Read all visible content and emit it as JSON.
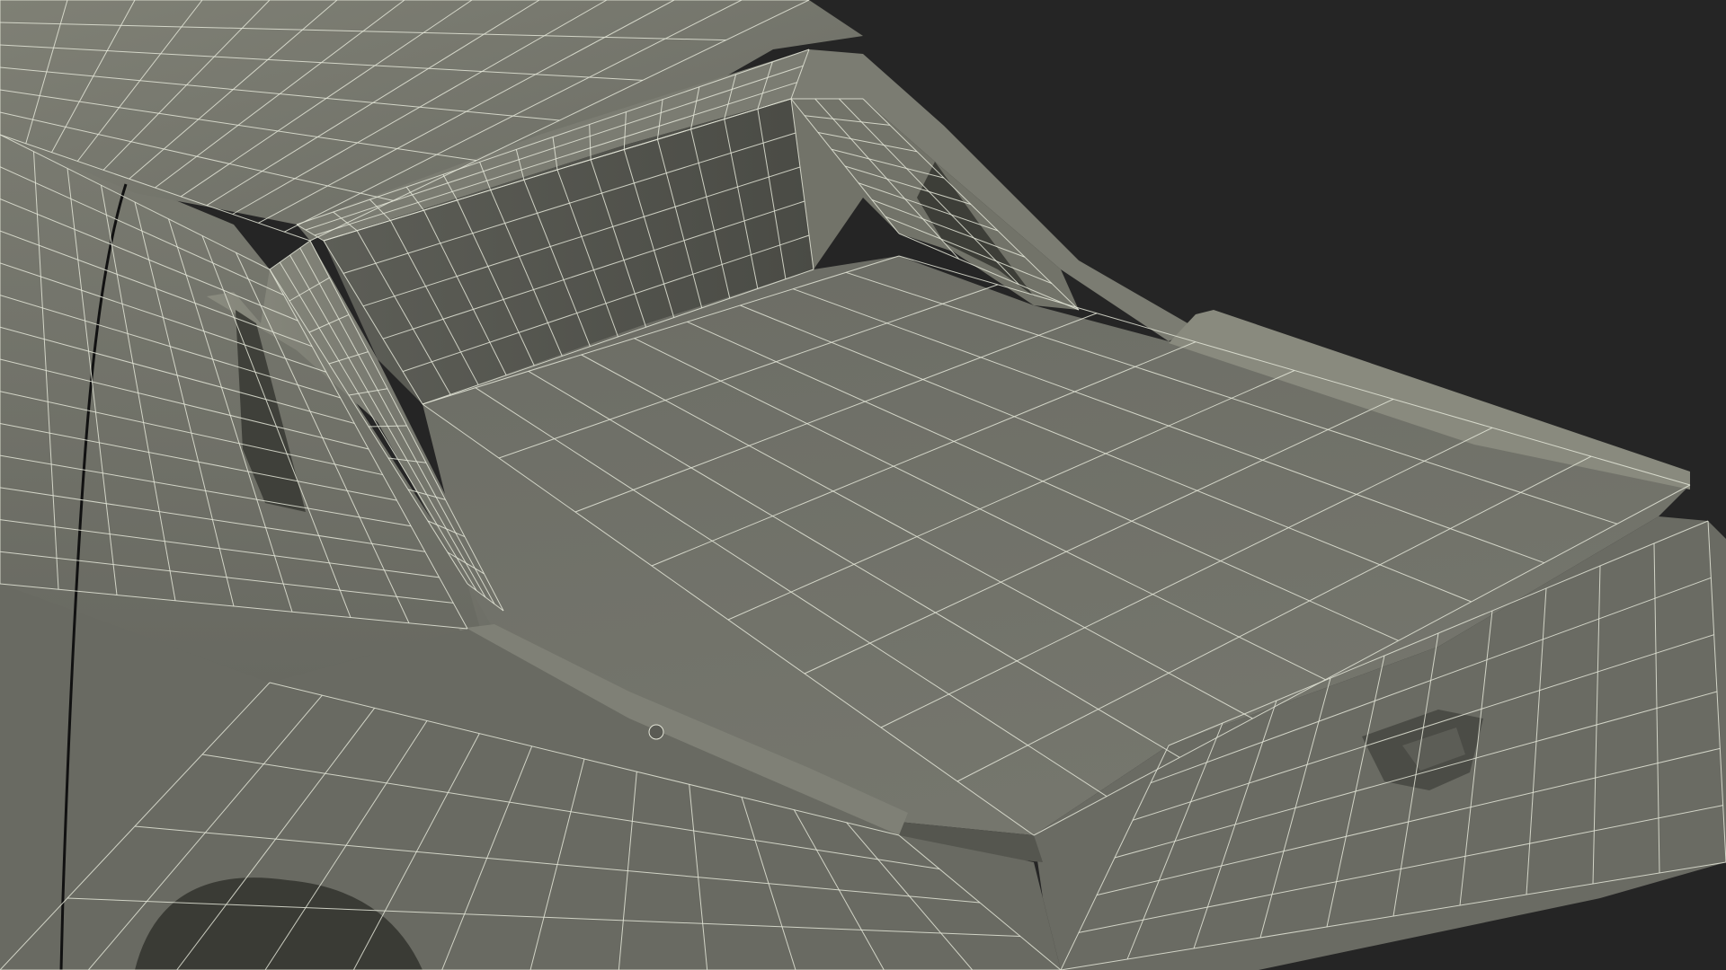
{
  "scene": {
    "subject": "pickup-truck-rear-wireframe",
    "colors": {
      "background": "#252525",
      "body": "#6f7068",
      "body_light": "#858678",
      "body_dark": "#4d4e48",
      "shadow": "#34352f",
      "wire": "#e4e6d8",
      "seam": "#111111"
    }
  }
}
